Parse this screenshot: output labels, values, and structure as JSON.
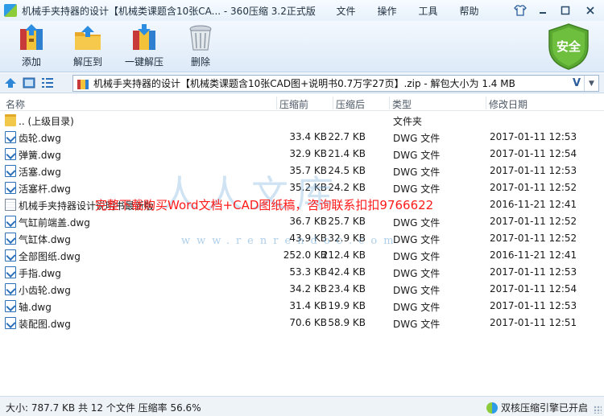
{
  "window": {
    "title": "机械手夹持器的设计【机械类课题含10张CA... - 360压缩 3.2正式版",
    "menu": [
      "文件",
      "操作",
      "工具",
      "帮助"
    ]
  },
  "toolbar": {
    "add_label": "添加",
    "extract_label": "解压到",
    "oneclick_label": "一键解压",
    "delete_label": "删除",
    "security_label": "安全"
  },
  "addressbar": {
    "path": "机械手夹持器的设计【机械类课题含10张CAD图+说明书0.7万字27页】.zip - 解包大小为 1.4 MB",
    "verify_mark": "V"
  },
  "columns": {
    "name": "名称",
    "size": "压缩前",
    "packed": "压缩后",
    "type": "类型",
    "modified": "修改日期"
  },
  "files": [
    {
      "name": ".. (上级目录)",
      "size": "",
      "packed": "",
      "type": "文件夹",
      "modified": "",
      "icon": "folder-icon"
    },
    {
      "name": "齿轮.dwg",
      "size": "33.4 KB",
      "packed": "22.7 KB",
      "type": "DWG 文件",
      "modified": "2017-01-11 12:53",
      "icon": "dwg-file-icon"
    },
    {
      "name": "弹簧.dwg",
      "size": "32.9 KB",
      "packed": "21.4 KB",
      "type": "DWG 文件",
      "modified": "2017-01-11 12:54",
      "icon": "dwg-file-icon"
    },
    {
      "name": "活塞.dwg",
      "size": "35.7 KB",
      "packed": "24.5 KB",
      "type": "DWG 文件",
      "modified": "2017-01-11 12:53",
      "icon": "dwg-file-icon"
    },
    {
      "name": "活塞杆.dwg",
      "size": "35.2 KB",
      "packed": "24.2 KB",
      "type": "DWG 文件",
      "modified": "2017-01-11 12:52",
      "icon": "dwg-file-icon"
    },
    {
      "name": "机械手夹持器设计说明书最新版",
      "size": "",
      "packed": "",
      "type": "",
      "modified": "2016-11-21 12:41",
      "icon": "doc-file-icon"
    },
    {
      "name": "气缸前端盖.dwg",
      "size": "36.7 KB",
      "packed": "25.7 KB",
      "type": "DWG 文件",
      "modified": "2017-01-11 12:52",
      "icon": "dwg-file-icon"
    },
    {
      "name": "气缸体.dwg",
      "size": "43.9 KB",
      "packed": "32.9 KB",
      "type": "DWG 文件",
      "modified": "2017-01-11 12:52",
      "icon": "dwg-file-icon"
    },
    {
      "name": "全部图纸.dwg",
      "size": "252.0 KB",
      "packed": "212.4 KB",
      "type": "DWG 文件",
      "modified": "2016-11-21 12:41",
      "icon": "dwg-file-icon"
    },
    {
      "name": "手指.dwg",
      "size": "53.3 KB",
      "packed": "42.4 KB",
      "type": "DWG 文件",
      "modified": "2017-01-11 12:53",
      "icon": "dwg-file-icon"
    },
    {
      "name": "小齿轮.dwg",
      "size": "34.2 KB",
      "packed": "23.4 KB",
      "type": "DWG 文件",
      "modified": "2017-01-11 12:54",
      "icon": "dwg-file-icon"
    },
    {
      "name": "轴.dwg",
      "size": "31.4 KB",
      "packed": "19.9 KB",
      "type": "DWG 文件",
      "modified": "2017-01-11 12:53",
      "icon": "dwg-file-icon"
    },
    {
      "name": "装配图.dwg",
      "size": "70.6 KB",
      "packed": "58.9 KB",
      "type": "DWG 文件",
      "modified": "2017-01-11 12:51",
      "icon": "dwg-file-icon"
    }
  ],
  "watermark": {
    "logo": "人人文库",
    "url": "www.renrendoc.com",
    "overlay": "完整下载购买Word文档+CAD图纸稿，咨询联系扣扣9766622"
  },
  "status": {
    "left": "大小: 787.7 KB 共 12 个文件 压缩率 56.6%",
    "right": "双核压缩引擎已开启"
  },
  "colors": {
    "titlebar": "#e7f1fb",
    "toolbar": "#ddeaf8",
    "accent": "#2a6fb8",
    "shield": "#5aa832",
    "watermark_red": "#ff1a1a"
  }
}
